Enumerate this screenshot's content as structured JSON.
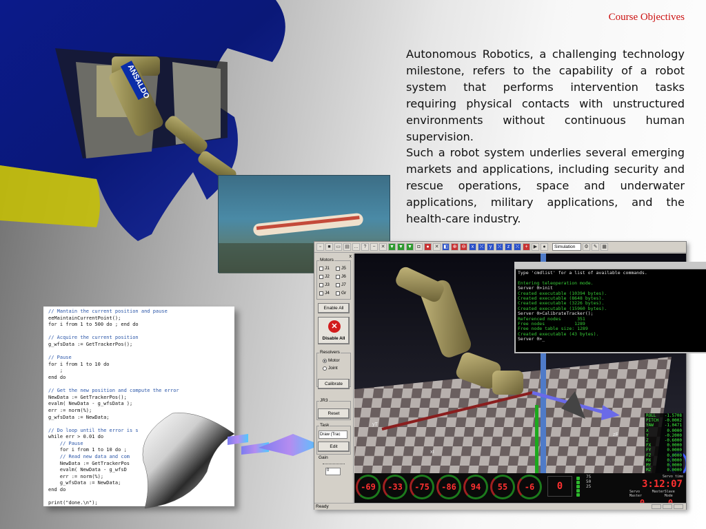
{
  "slide": {
    "title": "Course Objectives",
    "paragraphs": [
      "Autonomous Robotics, a challenging technology milestone, refers to the capability of a robot system that performs intervention tasks requiring physical contacts with unstructured environments without continuous human supervision.",
      "Such a robot system underlies several emerging markets and applications, including security and rescue operations, space and underwater applications, military applications, and the health-care industry."
    ]
  },
  "robot_image": {
    "brand_label": "ANSALDO"
  },
  "code_listing": [
    {
      "text": "// Mantain the current position and pause",
      "kind": "comment"
    },
    {
      "text": "eeMaintainCurrentPoint();",
      "kind": "code"
    },
    {
      "text": "for i from 1 to 500 do ; end do",
      "kind": "code"
    },
    {
      "text": "",
      "kind": "blank"
    },
    {
      "text": "// Acquire the current position",
      "kind": "comment"
    },
    {
      "text": "g_wfsData := GetTrackerPos();",
      "kind": "code"
    },
    {
      "text": "",
      "kind": "blank"
    },
    {
      "text": "// Pause",
      "kind": "comment"
    },
    {
      "text": "for i from 1 to 10 do",
      "kind": "code"
    },
    {
      "text": "    ;",
      "kind": "code"
    },
    {
      "text": "end do",
      "kind": "code"
    },
    {
      "text": "",
      "kind": "blank"
    },
    {
      "text": "// Get the new position and compute the error",
      "kind": "comment"
    },
    {
      "text": "NewData := GetTrackerPos();",
      "kind": "code"
    },
    {
      "text": "evalm( NewData - g_wfsData );",
      "kind": "code"
    },
    {
      "text": "err := norm(%);",
      "kind": "code"
    },
    {
      "text": "g_wfsData := NewData;",
      "kind": "code"
    },
    {
      "text": "",
      "kind": "blank"
    },
    {
      "text": "// Do loop until the error is s",
      "kind": "comment"
    },
    {
      "text": "while err > 0.01 do",
      "kind": "code"
    },
    {
      "text": "    // Pause",
      "kind": "comment"
    },
    {
      "text": "    for i from 1 to 10 do ;",
      "kind": "code"
    },
    {
      "text": "    // Read new data and com",
      "kind": "comment"
    },
    {
      "text": "    NewData := GetTrackerPos",
      "kind": "code"
    },
    {
      "text": "    evalm( NewData - g_wfsD",
      "kind": "code"
    },
    {
      "text": "    err := norm(%);",
      "kind": "code"
    },
    {
      "text": "    g_wfsData := NewData;",
      "kind": "code"
    },
    {
      "text": "end do",
      "kind": "code"
    },
    {
      "text": "",
      "kind": "blank"
    },
    {
      "text": "print(\"done.\\n\");",
      "kind": "code"
    }
  ],
  "app": {
    "toolbar": {
      "simulation_select": "Simulation"
    },
    "panel": {
      "close_glyph": "x",
      "motors_label": "Motors",
      "joints": [
        "J1",
        "J2",
        "J3",
        "J4",
        "J5",
        "J6",
        "J7",
        "Gr"
      ],
      "enable_all": "Enable All",
      "disable_all": "Disable All",
      "resolvers_label": "Resolvers",
      "motor_option": "Motor",
      "joint_option": "Joint",
      "calibrate": "Calibrate",
      "jr3_label": "JR3",
      "reset": "Reset",
      "task_label": "Task",
      "task_value": "Draw (Trac",
      "edit": "Edit",
      "gain_label": "Gain",
      "gain_value": "0"
    },
    "console": {
      "lines": [
        {
          "text": "Type 'cmdlist' for a list of available commands.",
          "color": "white"
        },
        {
          "text": "",
          "color": "white"
        },
        {
          "text": "Entering teleoperation mode.",
          "color": "green"
        },
        {
          "text": "Server 0>init",
          "color": "white"
        },
        {
          "text": "Created executable (10394 bytes).",
          "color": "green"
        },
        {
          "text": "Created executable (8648 bytes).",
          "color": "green"
        },
        {
          "text": "Created executable (3226 bytes).",
          "color": "green"
        },
        {
          "text": "Created executable (15960 bytes).",
          "color": "green"
        },
        {
          "text": "Server 0>CalibrateTracker();",
          "color": "white"
        },
        {
          "text": "Referenced nodes      351",
          "color": "green"
        },
        {
          "text": "Free nodes           1289",
          "color": "green"
        },
        {
          "text": "Free node table size: 1289",
          "color": "green"
        },
        {
          "text": "Created executable (43 bytes).",
          "color": "green"
        },
        {
          "text": "Server 0>_",
          "color": "white"
        }
      ]
    },
    "axes": {
      "y": "yT",
      "x": "xt",
      "z": "zF"
    },
    "readout": [
      {
        "label": "ROLL",
        "value": "-1.5708"
      },
      {
        "label": "PITCH",
        "value": "-0.0002"
      },
      {
        "label": "YAW",
        "value": "-1.0471"
      },
      {
        "label": "X",
        "value": "0.0000"
      },
      {
        "label": "Y",
        "value": "-0.2000"
      },
      {
        "label": "Z",
        "value": "-0.6000"
      },
      {
        "label": "FX",
        "value": "0.0000"
      },
      {
        "label": "FY",
        "value": "0.0000"
      },
      {
        "label": "FZ",
        "value": "0.0000"
      },
      {
        "label": "MX",
        "value": "0.0000"
      },
      {
        "label": "MY",
        "value": "0.0000"
      },
      {
        "label": "MZ",
        "value": "0.0000"
      }
    ],
    "gauges": [
      "-69",
      "-33",
      "-75",
      "-86",
      "94",
      "55",
      "-6"
    ],
    "gripper_value": "0",
    "force_labels": [
      "75",
      "50",
      "25"
    ],
    "clock": {
      "label": "Servo time",
      "time": "3:12:07",
      "labels": [
        "Servo Master",
        "Master",
        "Slave Mode"
      ],
      "values": [
        "0",
        "0"
      ]
    },
    "status": "Ready"
  },
  "colors": {
    "title_red": "#cc1111",
    "console_green": "#38d038",
    "gauge_red": "#ff3030"
  }
}
